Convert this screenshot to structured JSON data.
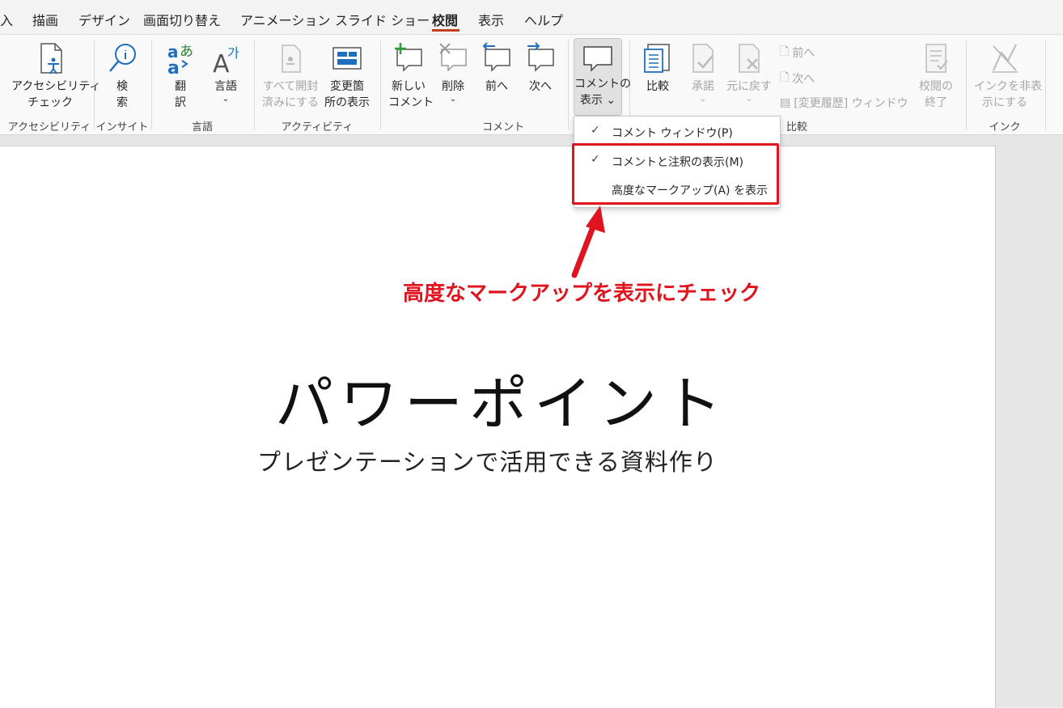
{
  "tabs": [
    {
      "label": "入"
    },
    {
      "label": "描画"
    },
    {
      "label": "デザイン"
    },
    {
      "label": "画面切り替え"
    },
    {
      "label": "アニメーション"
    },
    {
      "label": "スライド ショー"
    },
    {
      "label": "校閲"
    },
    {
      "label": "表示"
    },
    {
      "label": "ヘルプ"
    }
  ],
  "ribbon": {
    "accessibility": {
      "line1": "アクセシビリティ",
      "line2": "チェック",
      "group": "アクセシビリティ"
    },
    "insights": {
      "line1": "検",
      "line2": "索",
      "group": "インサイト"
    },
    "language": {
      "translate1": "翻",
      "translate2": "訳",
      "language": "言語",
      "group": "言語"
    },
    "activity": {
      "allopen1": "すべて開封",
      "allopen2": "済みにする",
      "changes1": "変更箇",
      "changes2": "所の表示",
      "group": "アクティビティ"
    },
    "comments": {
      "new1": "新しい",
      "new2": "コメント",
      "delete": "削除",
      "prev": "前へ",
      "next": "次へ",
      "show1": "コメントの",
      "show2": "表示",
      "group": "コメント"
    },
    "compare": {
      "compare": "比較",
      "accept": "承諾",
      "reject": "元に戻す",
      "prev": "前へ",
      "next": "次へ",
      "pane": "[変更履歴] ウィンドウ",
      "end1": "校閲の",
      "end2": "終了",
      "group": "比較"
    },
    "ink": {
      "hide1": "インクを非表",
      "hide2": "示にする",
      "group": "インク"
    }
  },
  "dropdown": {
    "items": [
      {
        "label": "コメント ウィンドウ(P)",
        "checked": true
      },
      {
        "label": "コメントと注釈の表示(M)",
        "checked": true
      },
      {
        "label": "高度なマークアップ(A) を表示",
        "checked": false
      }
    ],
    "check_glyph": "✓"
  },
  "annotation": {
    "text": "高度なマークアップを表示にチェック",
    "color": "#e0141e"
  },
  "slide": {
    "title": "パワーポイント",
    "subtitle": "プレゼンテーションで活用できる資料作り"
  },
  "colors": {
    "accent": "#c43e1c",
    "annotation": "#e0141e",
    "icon_blue": "#1e6fc0"
  }
}
